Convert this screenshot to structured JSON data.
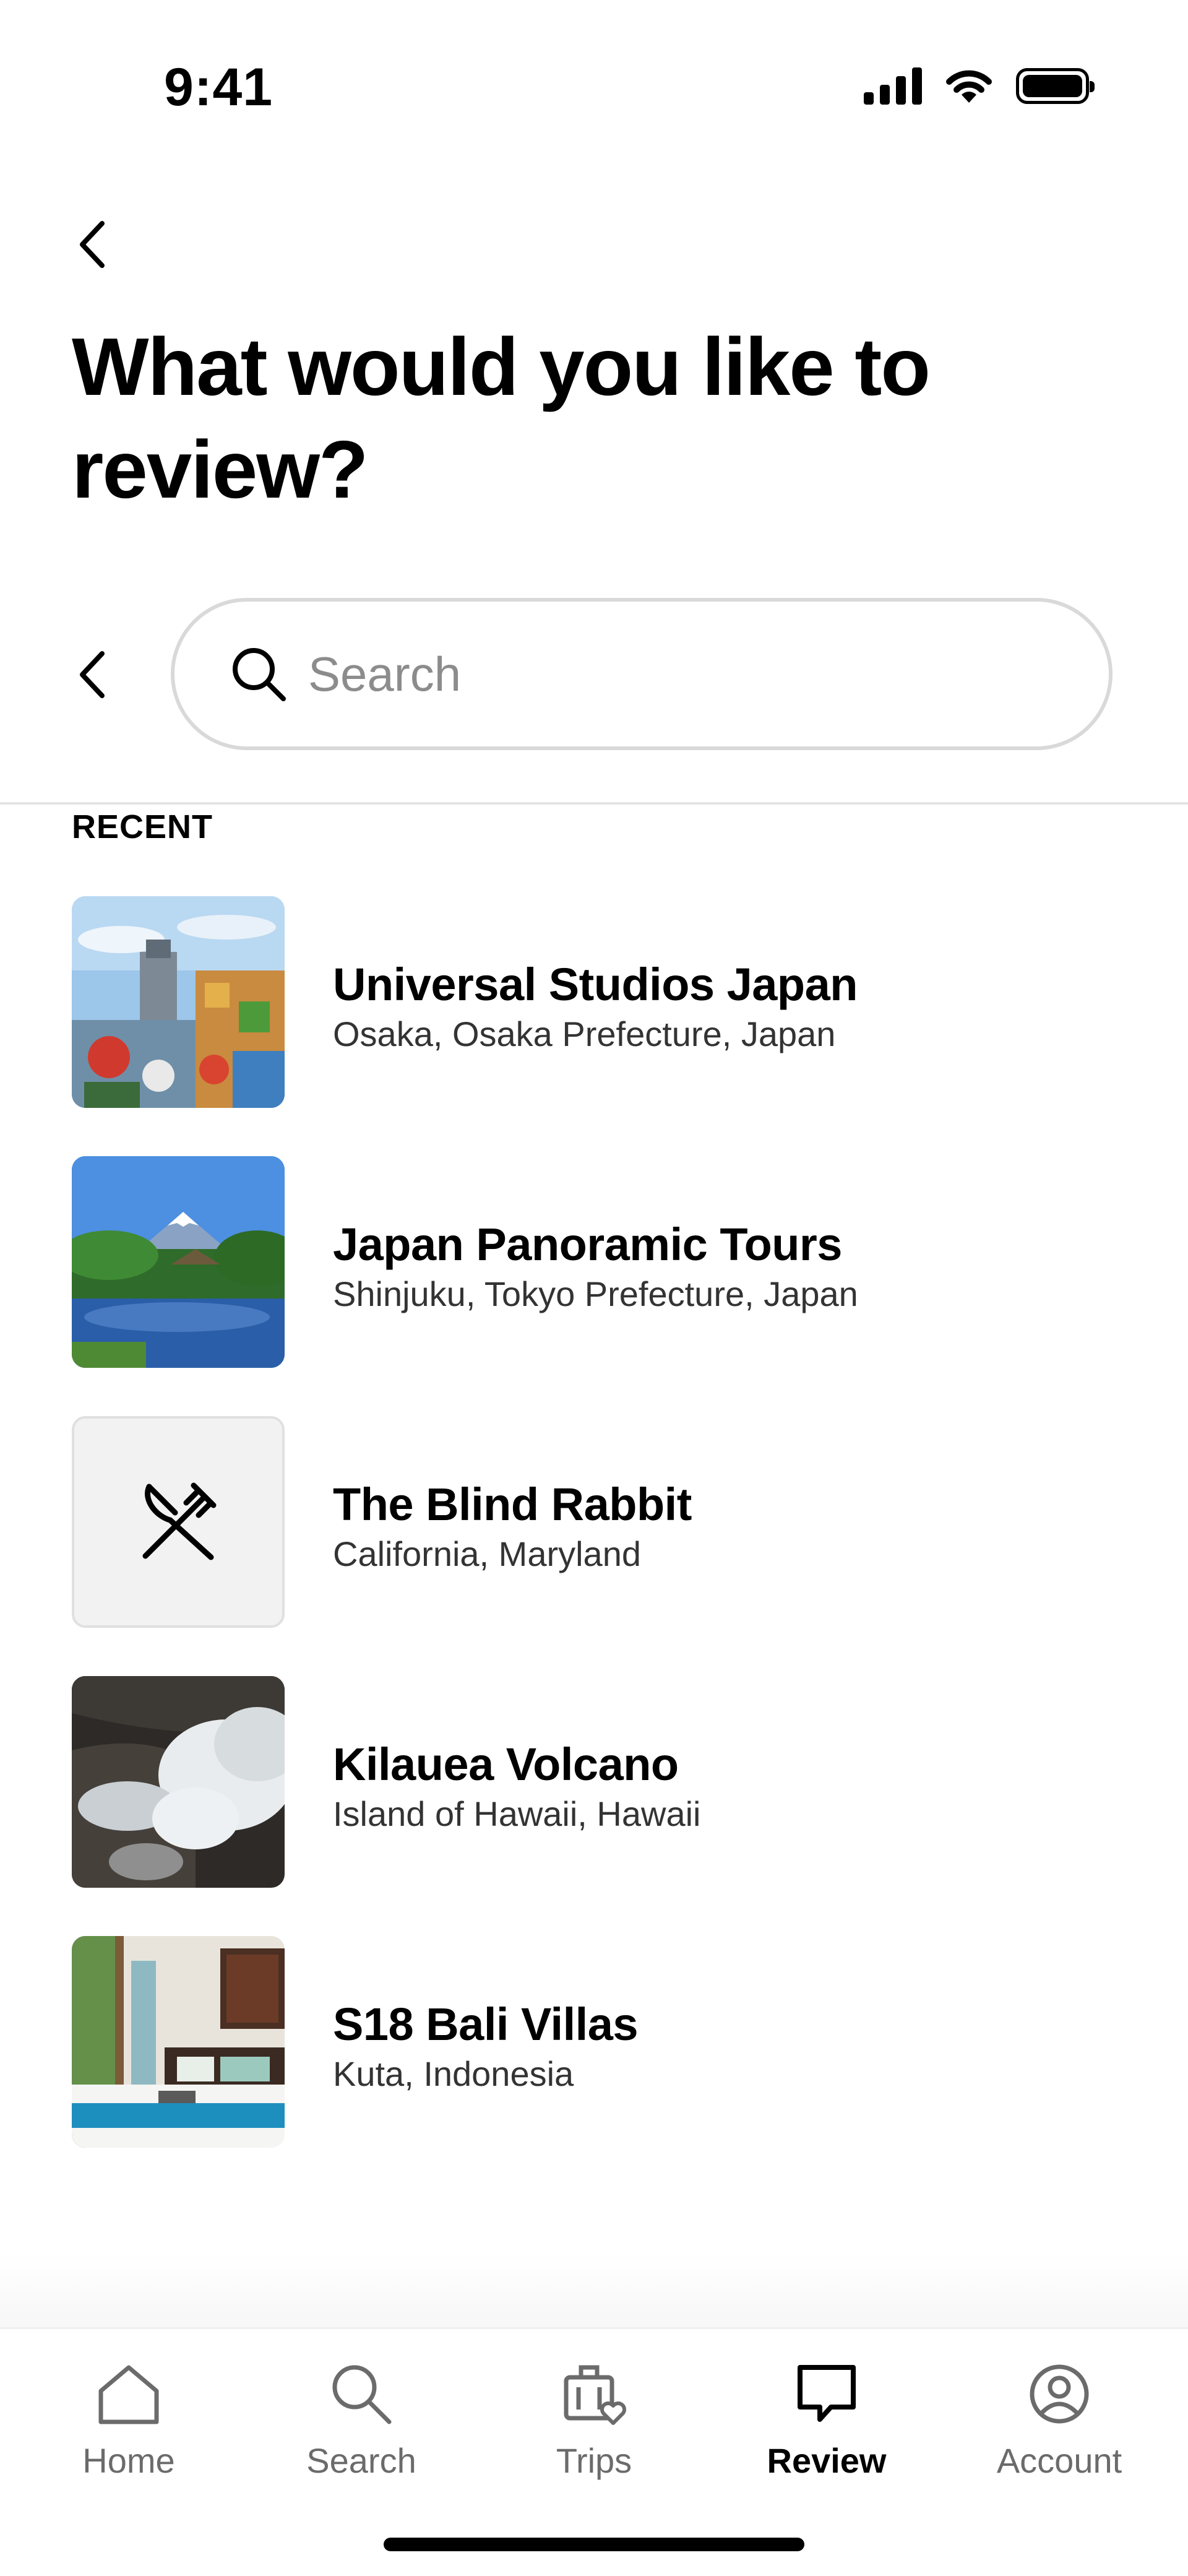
{
  "status_bar": {
    "time": "9:41"
  },
  "page": {
    "title": "What would you like to review?"
  },
  "search": {
    "placeholder": "Search",
    "value": ""
  },
  "recent": {
    "label": "RECENT",
    "items": [
      {
        "title": "Universal Studios Japan",
        "subtitle": "Osaka, Osaka Prefecture, Japan",
        "thumbnail": "theme-park-photo"
      },
      {
        "title": "Japan Panoramic Tours",
        "subtitle": "Shinjuku, Tokyo Prefecture, Japan",
        "thumbnail": "mount-fuji-photo"
      },
      {
        "title": "The Blind Rabbit",
        "subtitle": "California, Maryland",
        "thumbnail": "fork-knife-icon"
      },
      {
        "title": "Kilauea Volcano",
        "subtitle": "Island of Hawaii, Hawaii",
        "thumbnail": "volcano-photo"
      },
      {
        "title": "S18 Bali Villas",
        "subtitle": "Kuta, Indonesia",
        "thumbnail": "villa-bedroom-photo"
      }
    ]
  },
  "bottom_nav": {
    "items": [
      {
        "label": "Home",
        "icon": "home-icon",
        "active": false
      },
      {
        "label": "Search",
        "icon": "search-icon",
        "active": false
      },
      {
        "label": "Trips",
        "icon": "suitcase-heart-icon",
        "active": false
      },
      {
        "label": "Review",
        "icon": "speech-bubble-icon",
        "active": true
      },
      {
        "label": "Account",
        "icon": "user-circle-icon",
        "active": false
      }
    ]
  },
  "colors": {
    "text": "#000000",
    "muted": "#6b6b6b",
    "border": "#d9d9d9",
    "placeholder_bg": "#f2f2f2"
  }
}
